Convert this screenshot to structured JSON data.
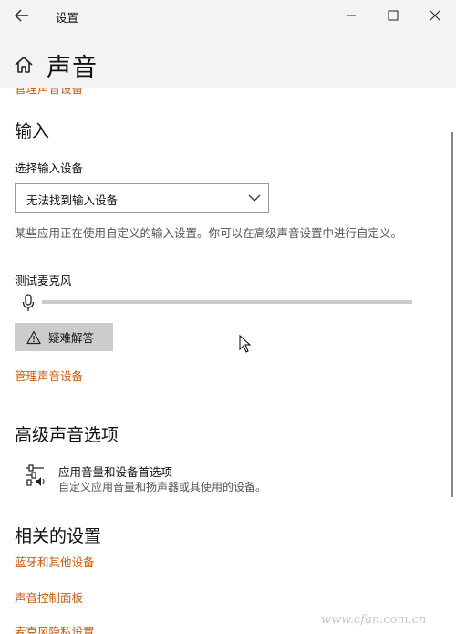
{
  "window": {
    "title": "设置",
    "controls": {
      "back": "back-arrow-icon",
      "minimize": "minimize-icon",
      "maximize": "maximize-icon",
      "close": "close-icon"
    }
  },
  "page": {
    "title": "声音",
    "home_icon": "home-icon"
  },
  "content": {
    "cut_off_link": "管理声音设备",
    "input": {
      "heading": "输入",
      "select_label": "选择输入设备",
      "select_value": "无法找到输入设备",
      "description": "某些应用正在使用自定义的输入设置。你可以在高级声音设置中进行自定义。",
      "mic_test_label": "测试麦克风",
      "mic_level": 0,
      "troubleshoot_label": "疑难解答",
      "manage_devices_link": "管理声音设备"
    },
    "advanced": {
      "heading": "高级声音选项",
      "item_title": "应用音量和设备首选项",
      "item_subtitle": "自定义应用音量和扬声器或其使用的设备。"
    },
    "related": {
      "heading": "相关的设置",
      "links": [
        "蓝牙和其他设备",
        "声音控制面板",
        "麦克风隐私设置"
      ]
    },
    "watermark": "www.cfan.com.cn"
  },
  "colors": {
    "accent_link": "#c55a11",
    "header_bg": "#f3f3f3",
    "button_bg": "#cccccc"
  }
}
